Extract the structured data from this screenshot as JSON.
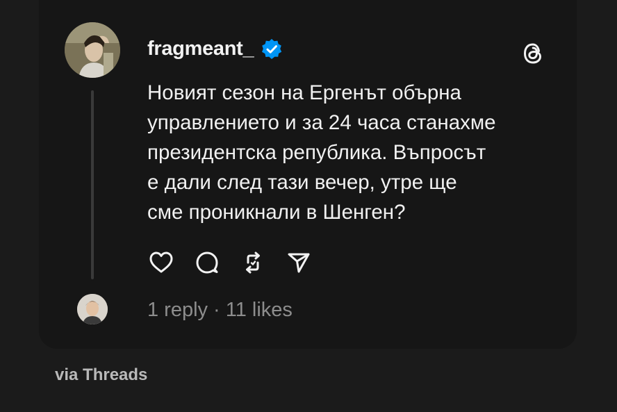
{
  "post": {
    "username": "fragmeant_",
    "verified_icon": "verified-badge-icon",
    "app_icon": "threads-logo-icon",
    "text": "Новият сезон на Ергенът обърна\nуправлението и за 24 часа станахме\nпрезидентска република. Въпросът\nе дали след тази вечер, утре ще\nсме проникнали в Шенген?",
    "actions": [
      "heart-icon",
      "comment-icon",
      "repost-icon",
      "share-icon"
    ],
    "replies": "1 reply",
    "separator": "·",
    "likes": "11 likes"
  },
  "footer": {
    "source": "via Threads"
  },
  "colors": {
    "background": "#1b1b1b",
    "card": "#161616",
    "verified_blue": "#0095f6",
    "text": "#f1f1f1",
    "muted": "#8d8d8d"
  }
}
